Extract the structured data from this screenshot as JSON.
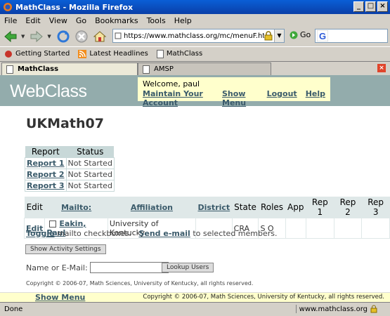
{
  "window": {
    "title": "MathClass - Mozilla Firefox",
    "minimize": "_",
    "maximize": "□",
    "close": "×"
  },
  "menu": [
    "File",
    "Edit",
    "View",
    "Go",
    "Bookmarks",
    "Tools",
    "Help"
  ],
  "address": {
    "url": "https://www.mathclass.org/mc/menuF.htm?lnkListId=",
    "go_label": "Go"
  },
  "bookmarks": [
    "Getting Started",
    "Latest Headlines",
    "MathClass"
  ],
  "tabs": [
    "MathClass",
    "AMSP"
  ],
  "page": {
    "logo": "WebClass",
    "welcome_label": "Welcome,",
    "user": "paul",
    "nav": [
      "Maintain Your Account",
      "Show Menu",
      "Logout",
      "Help"
    ],
    "title": "UKMath07",
    "reports": {
      "headers": [
        "Report",
        "Status"
      ],
      "rows": [
        {
          "name": "Report 1",
          "status": "Not Started"
        },
        {
          "name": "Report 2",
          "status": "Not Started"
        },
        {
          "name": "Report 3",
          "status": "Not Started"
        }
      ]
    },
    "members": {
      "headers": [
        "Edit",
        "Mailto:",
        "Affiliation",
        "District",
        "State",
        "Roles",
        "App",
        "Rep 1",
        "Rep 2",
        "Rep 3"
      ],
      "rows": [
        {
          "edit": "Edit",
          "name": "Eakin, Paul",
          "affiliation": "University of Kentucky",
          "district": "",
          "state": "CRA",
          "roles": "S O",
          "app": "",
          "rep1": "",
          "rep2": "",
          "rep3": ""
        }
      ]
    },
    "toggle_link": "Toggle",
    "toggle_text": "mailto checkboxes.",
    "send_link": "Send e-mail",
    "send_text": "to selected members.",
    "activity_button": "Show Activity Settings",
    "lookup_label": "Name or E-Mail:",
    "lookup_button": "Lookup Users",
    "copyright": "Copyright © 2006-07, Math Sciences, University of Kentucky, all rights reserved.",
    "footer_show_menu": "Show Menu",
    "footer_copyright": "Copyright © 2006-07, Math Sciences, University of Kentucky, all rights reserved."
  },
  "status": {
    "text": "Done",
    "domain": "www.mathclass.org"
  }
}
